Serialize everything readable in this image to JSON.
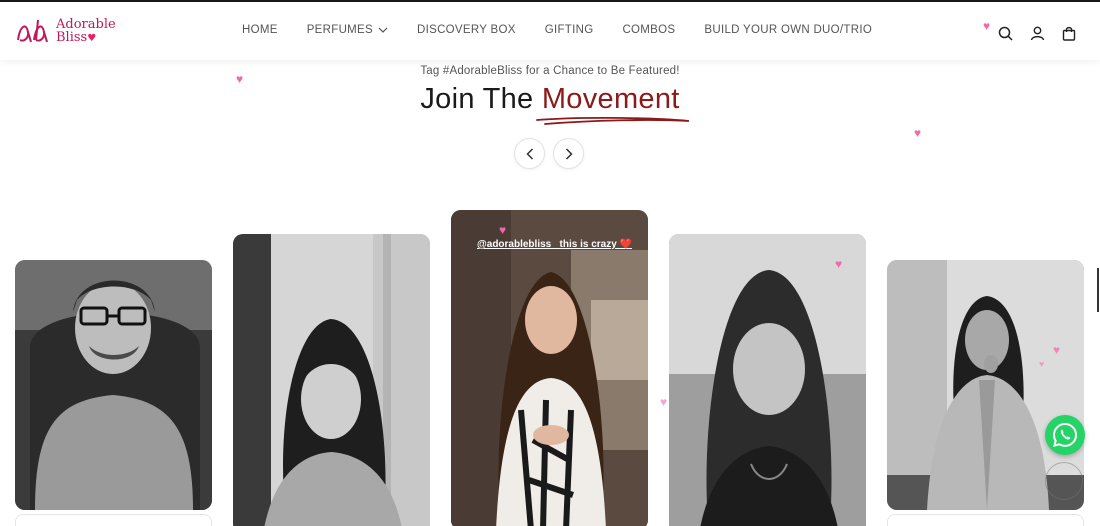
{
  "brand": {
    "line1": "Adorable",
    "line2": "Bliss",
    "heart": "♥"
  },
  "nav": [
    {
      "label": "HOME"
    },
    {
      "label": "PERFUMES",
      "dropdown": true
    },
    {
      "label": "DISCOVERY BOX"
    },
    {
      "label": "GIFTING"
    },
    {
      "label": "COMBOS"
    },
    {
      "label": "BUILD YOUR OWN DUO/TRIO"
    }
  ],
  "header_icons": [
    "search-icon",
    "account-icon",
    "bag-icon"
  ],
  "section": {
    "tagline": "Tag #AdorableBliss for a Chance to Be Featured!",
    "heading_plain": "Join The",
    "heading_accent": "Movement"
  },
  "carousel": {
    "prev_icon": "chevron-left-icon",
    "next_icon": "chevron-right-icon",
    "cards": [
      {
        "caption": ""
      },
      {
        "caption": ""
      },
      {
        "caption": "@adorablebliss_ this is crazy ❤️"
      },
      {
        "caption": ""
      },
      {
        "caption": ""
      }
    ]
  },
  "colors": {
    "brand_pink": "#c2185b",
    "accent": "#8b1a1a",
    "heart": "#ef6aa9",
    "whatsapp": "#25d366"
  },
  "floating_icons": [
    "whatsapp-icon",
    "scroll-top-button"
  ]
}
